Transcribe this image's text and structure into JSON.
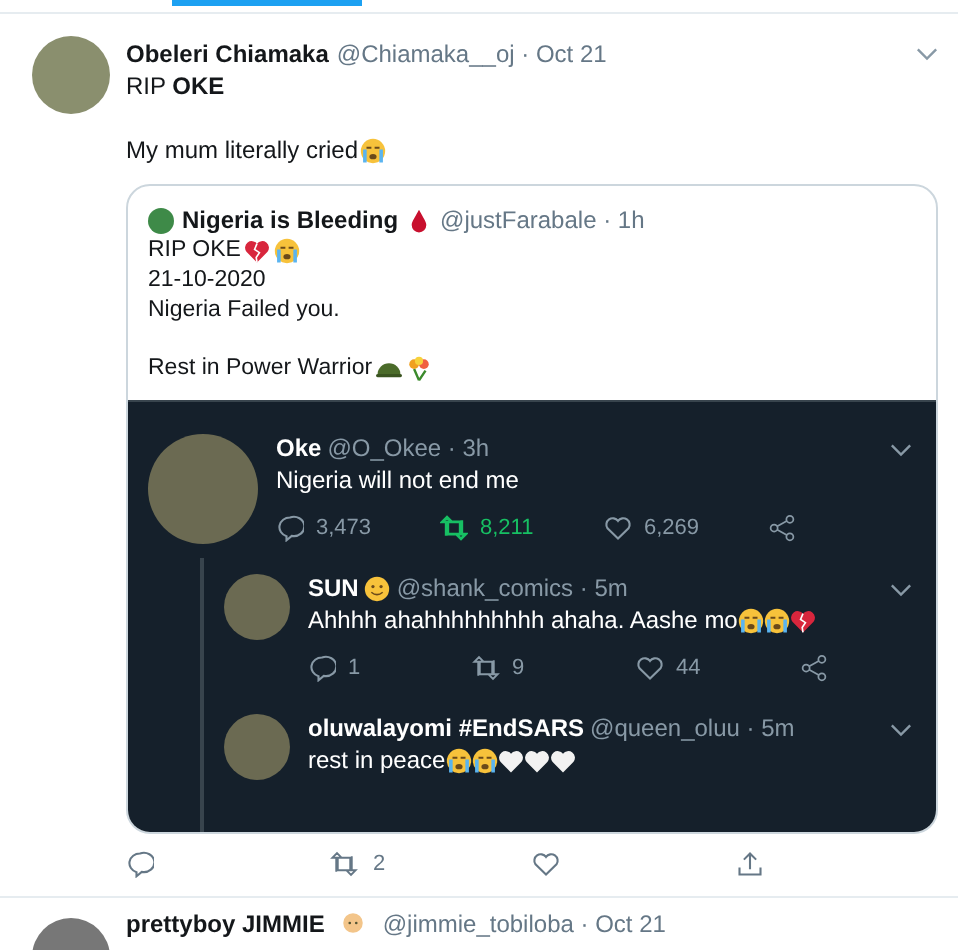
{
  "tweet": {
    "author": {
      "name": "Obeleri Chiamaka",
      "handle": "@Chiamaka__oj · Oct 21"
    },
    "paragraphs": [
      [
        {
          "text": "RIP **OKE**"
        }
      ],
      [
        {
          "text": "My mum literally cried",
          "emoji": [
            {
              "kind": "crying"
            }
          ]
        }
      ]
    ],
    "quote": {
      "author": {
        "name": "Nigeria is Bleeding",
        "handle": "@justFarabale · 1h",
        "emoji": [
          {
            "kind": "drop"
          }
        ]
      },
      "paragraphs": [
        [
          {
            "text": "RIP OKE",
            "emoji": [
              {
                "kind": "broken-heart"
              },
              {
                "kind": "crying"
              }
            ]
          },
          {
            "text": "21-10-2020"
          },
          {
            "text": "Nigeria Failed you."
          }
        ],
        [
          {
            "text": "Rest in Power Warrior",
            "emoji": [
              {
                "kind": "helmet"
              },
              {
                "kind": "bouquet"
              }
            ]
          }
        ]
      ],
      "image": {
        "replies": [
          {
            "name": "Oke",
            "handle": "@O_Okee · 3h",
            "text": "Nigeria will not end me",
            "actions": {
              "replies": "3,473",
              "retweets": "8,211",
              "likes": "6,269",
              "retweeted": true
            }
          },
          {
            "name": "SUN",
            "name_emoji": [
              {
                "kind": "smile"
              }
            ],
            "handle": "@shank_comics · 5m",
            "text": "Ahhhh ahahhhhhhhhh ahaha. Aashe mo",
            "emoji": [
              {
                "kind": "crying"
              },
              {
                "kind": "crying"
              },
              {
                "kind": "broken-heart"
              }
            ],
            "actions": {
              "replies": "1",
              "retweets": "9",
              "likes": "44",
              "retweeted": false
            }
          },
          {
            "name": "oluwalayomi #EndSARS",
            "handle": "@queen_oluu · 5m",
            "text": "rest in peace ",
            "emoji": [
              {
                "kind": "crying"
              },
              {
                "kind": "crying"
              },
              {
                "kind": "white-heart"
              },
              {
                "kind": "white-heart"
              },
              {
                "kind": "white-heart"
              }
            ]
          }
        ]
      }
    },
    "actions": {
      "retweets": "2"
    }
  },
  "next_tweet": {
    "name": "prettyboy JIMMIE",
    "name_emoji": [
      {
        "kind": "baby"
      }
    ],
    "handle": "@jimmie_tobiloba · Oct 21"
  }
}
